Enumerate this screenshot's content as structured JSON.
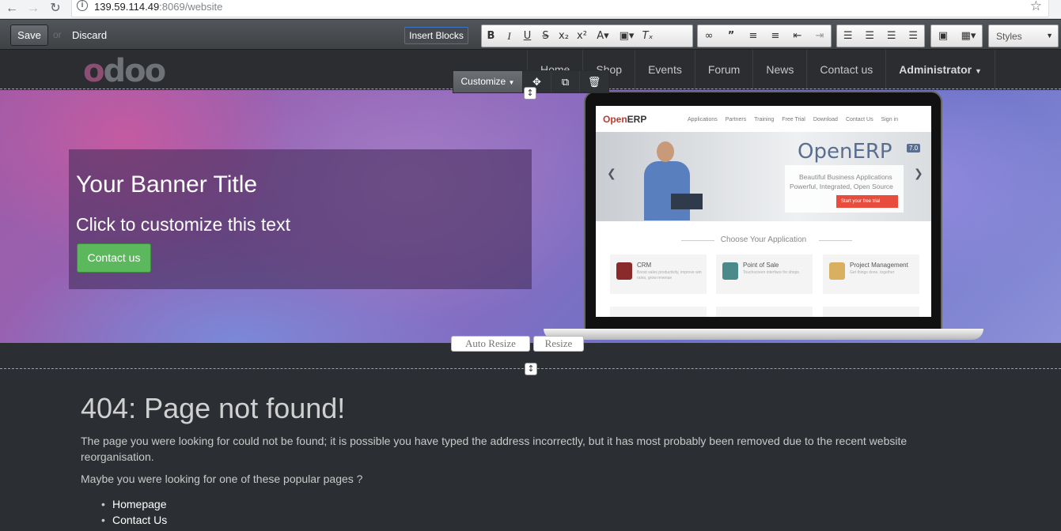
{
  "browser": {
    "url_host": "139.59.114.49",
    "url_path": ":8069/website"
  },
  "editor": {
    "save_label": "Save",
    "or_label": "or",
    "discard_label": "Discard",
    "insert_blocks_label": "Insert Blocks",
    "styles_label": "Styles"
  },
  "nav": {
    "logo": "odoo",
    "items": [
      "Home",
      "Shop",
      "Events",
      "Forum",
      "News",
      "Contact us"
    ],
    "admin_label": "Administrator"
  },
  "customize": {
    "label": "Customize"
  },
  "banner": {
    "title": "Your Banner Title",
    "subtitle": "Click to customize this text",
    "button_label": "Contact us"
  },
  "screen": {
    "logo_prefix": "Open",
    "logo_suffix": "ERP",
    "nav": [
      "Applications",
      "Partners",
      "Training",
      "Free Trial",
      "Download",
      "Contact Us",
      "Sign in"
    ],
    "brand": "OpenERP",
    "version": "7.0",
    "tagline1": "Beautiful Business Applications",
    "tagline2": "Powerful, Integrated, Open Source",
    "cta": "Start your free trial",
    "choose": "Choose Your Application",
    "apps": [
      {
        "title": "CRM",
        "desc": "Boost sales productivity, improve win rates, grow revenue"
      },
      {
        "title": "Point of Sale",
        "desc": "Touchscreen interface for shops"
      },
      {
        "title": "Project Management",
        "desc": "Get things done, together"
      }
    ]
  },
  "resize": {
    "auto_label": "Auto Resize",
    "resize_label": "Resize"
  },
  "content": {
    "heading": "404: Page not found!",
    "para1": "The page you were looking for could not be found; it is possible you have typed the address incorrectly, but it has most probably been removed due to the recent website reorganisation.",
    "para2": "Maybe you were looking for one of these popular pages ?",
    "links": [
      "Homepage",
      "Contact Us"
    ]
  }
}
